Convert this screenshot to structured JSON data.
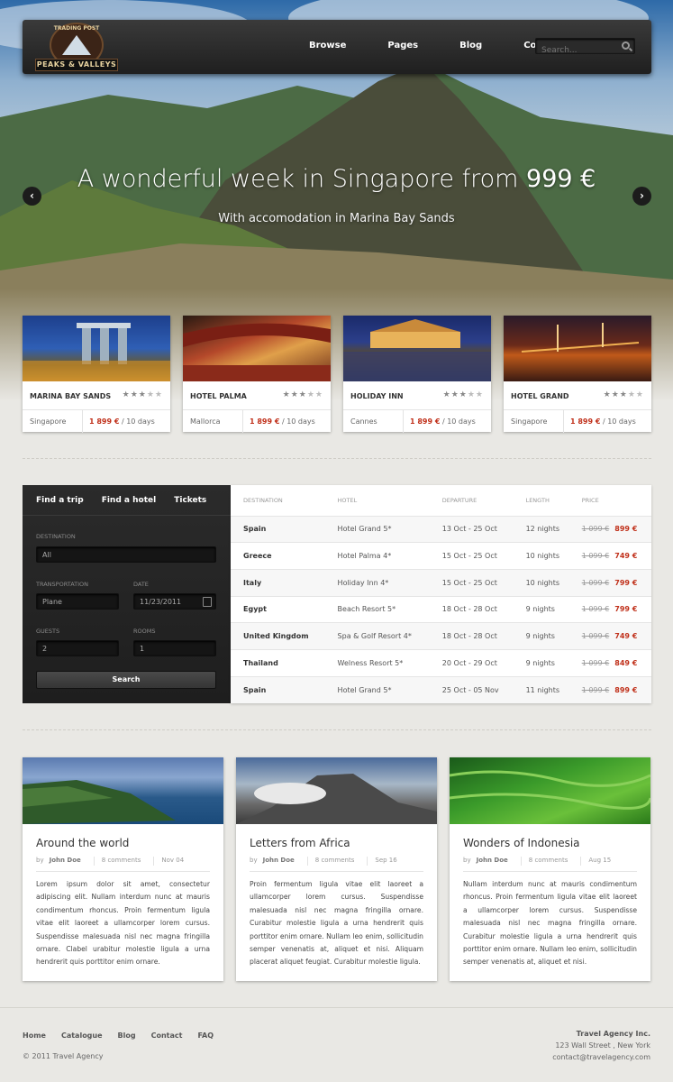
{
  "nav": {
    "logo_top": "TRADING POST",
    "logo_name": "PEAKS & VALLEYS",
    "menu": [
      "Browse",
      "Pages",
      "Blog",
      "Contact"
    ],
    "search_placeholder": "Search..."
  },
  "slider": {
    "title": "A wonderful week in Singapore from",
    "price": "999 €",
    "subtitle": "With accomodation in Marina Bay Sands",
    "prev_icon": "‹",
    "next_icon": "›"
  },
  "hotels": [
    {
      "name": "MARINA BAY SANDS",
      "stars": "★★★★★",
      "rating": 3,
      "location": "Singapore",
      "price": "1 899 €",
      "duration": "/ 10 days"
    },
    {
      "name": "HOTEL PALMA",
      "stars": "★★★★★",
      "rating": 3,
      "location": "Mallorca",
      "price": "1 899 €",
      "duration": "/ 10 days"
    },
    {
      "name": "HOLIDAY INN",
      "stars": "★★★★★",
      "rating": 3,
      "location": "Cannes",
      "price": "1 899 €",
      "duration": "/ 10 days"
    },
    {
      "name": "HOTEL GRAND",
      "stars": "★★★★★",
      "rating": 3,
      "location": "Singapore",
      "price": "1 899 €",
      "duration": "/ 10 days"
    }
  ],
  "booking": {
    "tabs": [
      "Find a trip",
      "Find a hotel",
      "Tickets"
    ],
    "destination_label": "DESTINATION",
    "destination_value": "All",
    "transportation_label": "TRANSPORTATION",
    "transportation_value": "Plane",
    "date_label": "DATE",
    "date_value": "11/23/2011",
    "guests_label": "GUESTS",
    "guests_value": "2",
    "rooms_label": "ROOMS",
    "rooms_value": "1",
    "search_label": "Search"
  },
  "deals": {
    "headers": [
      "DESTINATION",
      "HOTEL",
      "DEPARTURE",
      "LENGTH",
      "PRICE"
    ],
    "rows": [
      {
        "destination": "Spain",
        "hotel": "Hotel Grand 5*",
        "departure": "13 Oct - 25 Oct",
        "length": "12 nights",
        "old": "1 099 €",
        "price": "899 €"
      },
      {
        "destination": "Greece",
        "hotel": "Hotel Palma 4*",
        "departure": "15 Oct - 25 Oct",
        "length": "10 nights",
        "old": "1 099 €",
        "price": "749 €"
      },
      {
        "destination": "Italy",
        "hotel": "Holiday Inn 4*",
        "departure": "15 Oct - 25 Oct",
        "length": "10 nights",
        "old": "1 099 €",
        "price": "799 €"
      },
      {
        "destination": "Egypt",
        "hotel": "Beach Resort 5*",
        "departure": "18 Oct - 28 Oct",
        "length": "9 nights",
        "old": "1 099 €",
        "price": "799 €"
      },
      {
        "destination": "United Kingdom",
        "hotel": "Spa & Golf Resort 4*",
        "departure": "18 Oct - 28 Oct",
        "length": "9 nights",
        "old": "1 099 €",
        "price": "749 €"
      },
      {
        "destination": "Thailand",
        "hotel": "Welness Resort 5*",
        "departure": "20 Oct - 29 Oct",
        "length": "9 nights",
        "old": "1 099 €",
        "price": "849 €"
      },
      {
        "destination": "Spain",
        "hotel": "Hotel Grand 5*",
        "departure": "25 Oct - 05 Nov",
        "length": "11 nights",
        "old": "1 099 €",
        "price": "899 €"
      }
    ]
  },
  "posts": [
    {
      "title": "Around the world",
      "by": "by",
      "author": "John Doe",
      "comments": "8 comments",
      "date": "Nov 04",
      "text": "Lorem ipsum dolor sit amet, consectetur adipiscing elit. Nullam interdum nunc at mauris condimentum rhoncus. Proin fermentum ligula vitae elit laoreet a ullamcorper lorem cursus. Suspendisse malesuada nisl nec magna fringilla ornare. Clabel urabitur molestie ligula a urna hendrerit quis porttitor enim ornare."
    },
    {
      "title": "Letters from Africa",
      "by": "by",
      "author": "John Doe",
      "comments": "8 comments",
      "date": "Sep 16",
      "text": "Proin fermentum ligula vitae elit laoreet a ullamcorper lorem cursus. Suspendisse malesuada nisl nec magna fringilla ornare. Curabitur molestie ligula a urna hendrerit quis porttitor enim ornare. Nullam leo enim, sollicitudin semper venenatis at, aliquet et nisi. Aliquam placerat aliquet feugiat. Curabitur molestie ligula."
    },
    {
      "title": "Wonders of Indonesia",
      "by": "by",
      "author": "John Doe",
      "comments": "8 comments",
      "date": "Aug 15",
      "text": "Nullam interdum nunc at mauris condimentum rhoncus. Proin fermentum ligula vitae elit laoreet a ullamcorper lorem cursus. Suspendisse malesuada nisl nec magna fringilla ornare. Curabitur molestie ligula a urna hendrerit quis porttitor enim ornare. Nullam leo enim, sollicitudin semper venenatis at, aliquet et nisi."
    }
  ],
  "footer": {
    "links": [
      "Home",
      "Catalogue",
      "Blog",
      "Contact",
      "FAQ"
    ],
    "copyright": "© 2011 Travel Agency",
    "company": "Travel Agency Inc.",
    "street": "123 Wall Street , New York",
    "email": "contact@travelagency.com"
  },
  "colors": {
    "accent": "#c0301a",
    "nav": "#2a2a2a",
    "background": "#e9e8e4"
  }
}
